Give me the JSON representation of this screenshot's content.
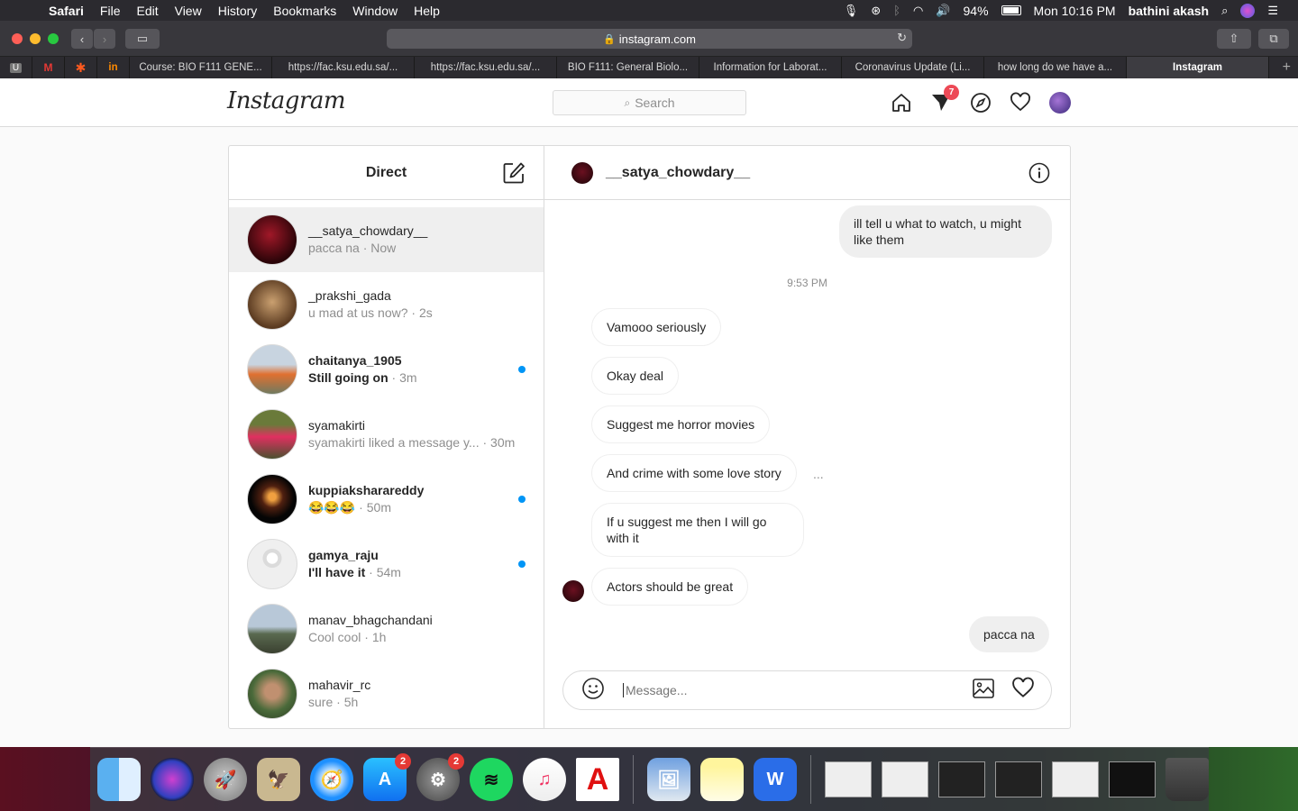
{
  "menubar": {
    "app": "Safari",
    "items": [
      "File",
      "Edit",
      "View",
      "History",
      "Bookmarks",
      "Window",
      "Help"
    ],
    "battery": "94%",
    "clock": "Mon 10:16 PM",
    "user": "bathini akash"
  },
  "browser": {
    "url": "instagram.com",
    "tabs": [
      "Course: BIO F111 GENE...",
      "https://fac.ksu.edu.sa/...",
      "https://fac.ksu.edu.sa/...",
      "BIO F111: General Biolo...",
      "Information for Laborat...",
      "Coronavirus Update (Li...",
      "how long do we have a...",
      "Instagram"
    ],
    "pinned": [
      "U",
      "M",
      "✱",
      "in"
    ]
  },
  "instagram": {
    "logo": "Instagram",
    "search_placeholder": "Search",
    "notification_count": "7",
    "direct": {
      "title": "Direct",
      "threads": [
        {
          "name": "__satya_chowdary__",
          "preview": "pacca na",
          "time": "Now",
          "unread": false
        },
        {
          "name": "_prakshi_gada",
          "preview": "u mad at us now?",
          "time": "2s",
          "unread": false
        },
        {
          "name": "chaitanya_1905",
          "preview": "Still going on",
          "time": "3m",
          "unread": true
        },
        {
          "name": "syamakirti",
          "preview": "syamakirti liked a message y...",
          "time": "30m",
          "unread": false
        },
        {
          "name": "kuppiaksharareddy",
          "preview": "😂😂😂",
          "time": "50m",
          "unread": true
        },
        {
          "name": "gamya_raju",
          "preview": "I'll have it",
          "time": "54m",
          "unread": true
        },
        {
          "name": "manav_bhagchandani",
          "preview": "Cool cool",
          "time": "1h",
          "unread": false
        },
        {
          "name": "mahavir_rc",
          "preview": "sure",
          "time": "5h",
          "unread": false
        }
      ]
    },
    "chat": {
      "username": "__satya_chowdary__",
      "timestamp": "9:53 PM",
      "messages": [
        {
          "from": "me",
          "text": "ill tell u what to watch, u might like them"
        },
        {
          "from": "them",
          "text": "Vamooo seriously"
        },
        {
          "from": "them",
          "text": "Okay deal"
        },
        {
          "from": "them",
          "text": "Suggest me horror movies"
        },
        {
          "from": "them",
          "text": "And crime with some love story"
        },
        {
          "from": "them",
          "text": "If u suggest me then I will go with it"
        },
        {
          "from": "them",
          "text": "Actors should be great"
        },
        {
          "from": "me",
          "text": "pacca na"
        }
      ],
      "more_options": "...",
      "input_placeholder": "Message..."
    }
  },
  "dock": {
    "badges": {
      "app_store": "2",
      "system_prefs": "2"
    }
  }
}
